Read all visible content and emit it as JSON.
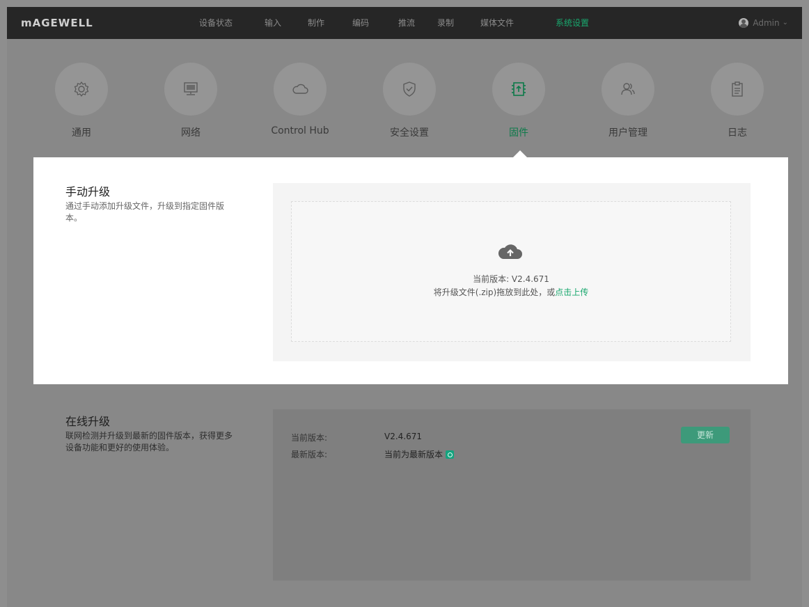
{
  "header": {
    "brand": "mAGEWELL",
    "nav": [
      {
        "label": "设备状态",
        "active": false
      },
      {
        "label": "输入",
        "active": false
      },
      {
        "label": "制作",
        "active": false
      },
      {
        "label": "编码",
        "active": false
      },
      {
        "label": "推流",
        "active": false
      },
      {
        "label": "录制",
        "active": false
      },
      {
        "label": "媒体文件",
        "active": false
      },
      {
        "label": "系统设置",
        "active": true
      }
    ],
    "user": "Admin",
    "user_dropdown_icon": "chevron-down-icon"
  },
  "categories": [
    {
      "label": "通用",
      "icon": "gear-icon",
      "active": false
    },
    {
      "label": "网络",
      "icon": "monitor-icon",
      "active": false
    },
    {
      "label": "Control Hub",
      "icon": "cloud-icon",
      "active": false
    },
    {
      "label": "安全设置",
      "icon": "shield-icon",
      "active": false
    },
    {
      "label": "固件",
      "icon": "firmware-upload-icon",
      "active": true
    },
    {
      "label": "用户管理",
      "icon": "users-icon",
      "active": false
    },
    {
      "label": "日志",
      "icon": "clipboard-icon",
      "active": false
    }
  ],
  "manual": {
    "title": "手动升级",
    "desc": "通过手动添加升级文件，升级到指定固件版本。",
    "current_version": "当前版本: V2.4.671",
    "hint_prefix": "将升级文件(.zip)拖放到此处，或",
    "hint_link": "点击上传"
  },
  "online": {
    "title": "在线升级",
    "desc": "联网检测并升级到最新的固件版本，获得更多设备功能和更好的使用体验。",
    "current_label": "当前版本:",
    "current_value": "V2.4.671",
    "latest_label": "最新版本:",
    "latest_value": "当前为最新版本",
    "update_button": "更新"
  },
  "colors": {
    "accent": "#19a86e",
    "topbar": "#262626"
  }
}
